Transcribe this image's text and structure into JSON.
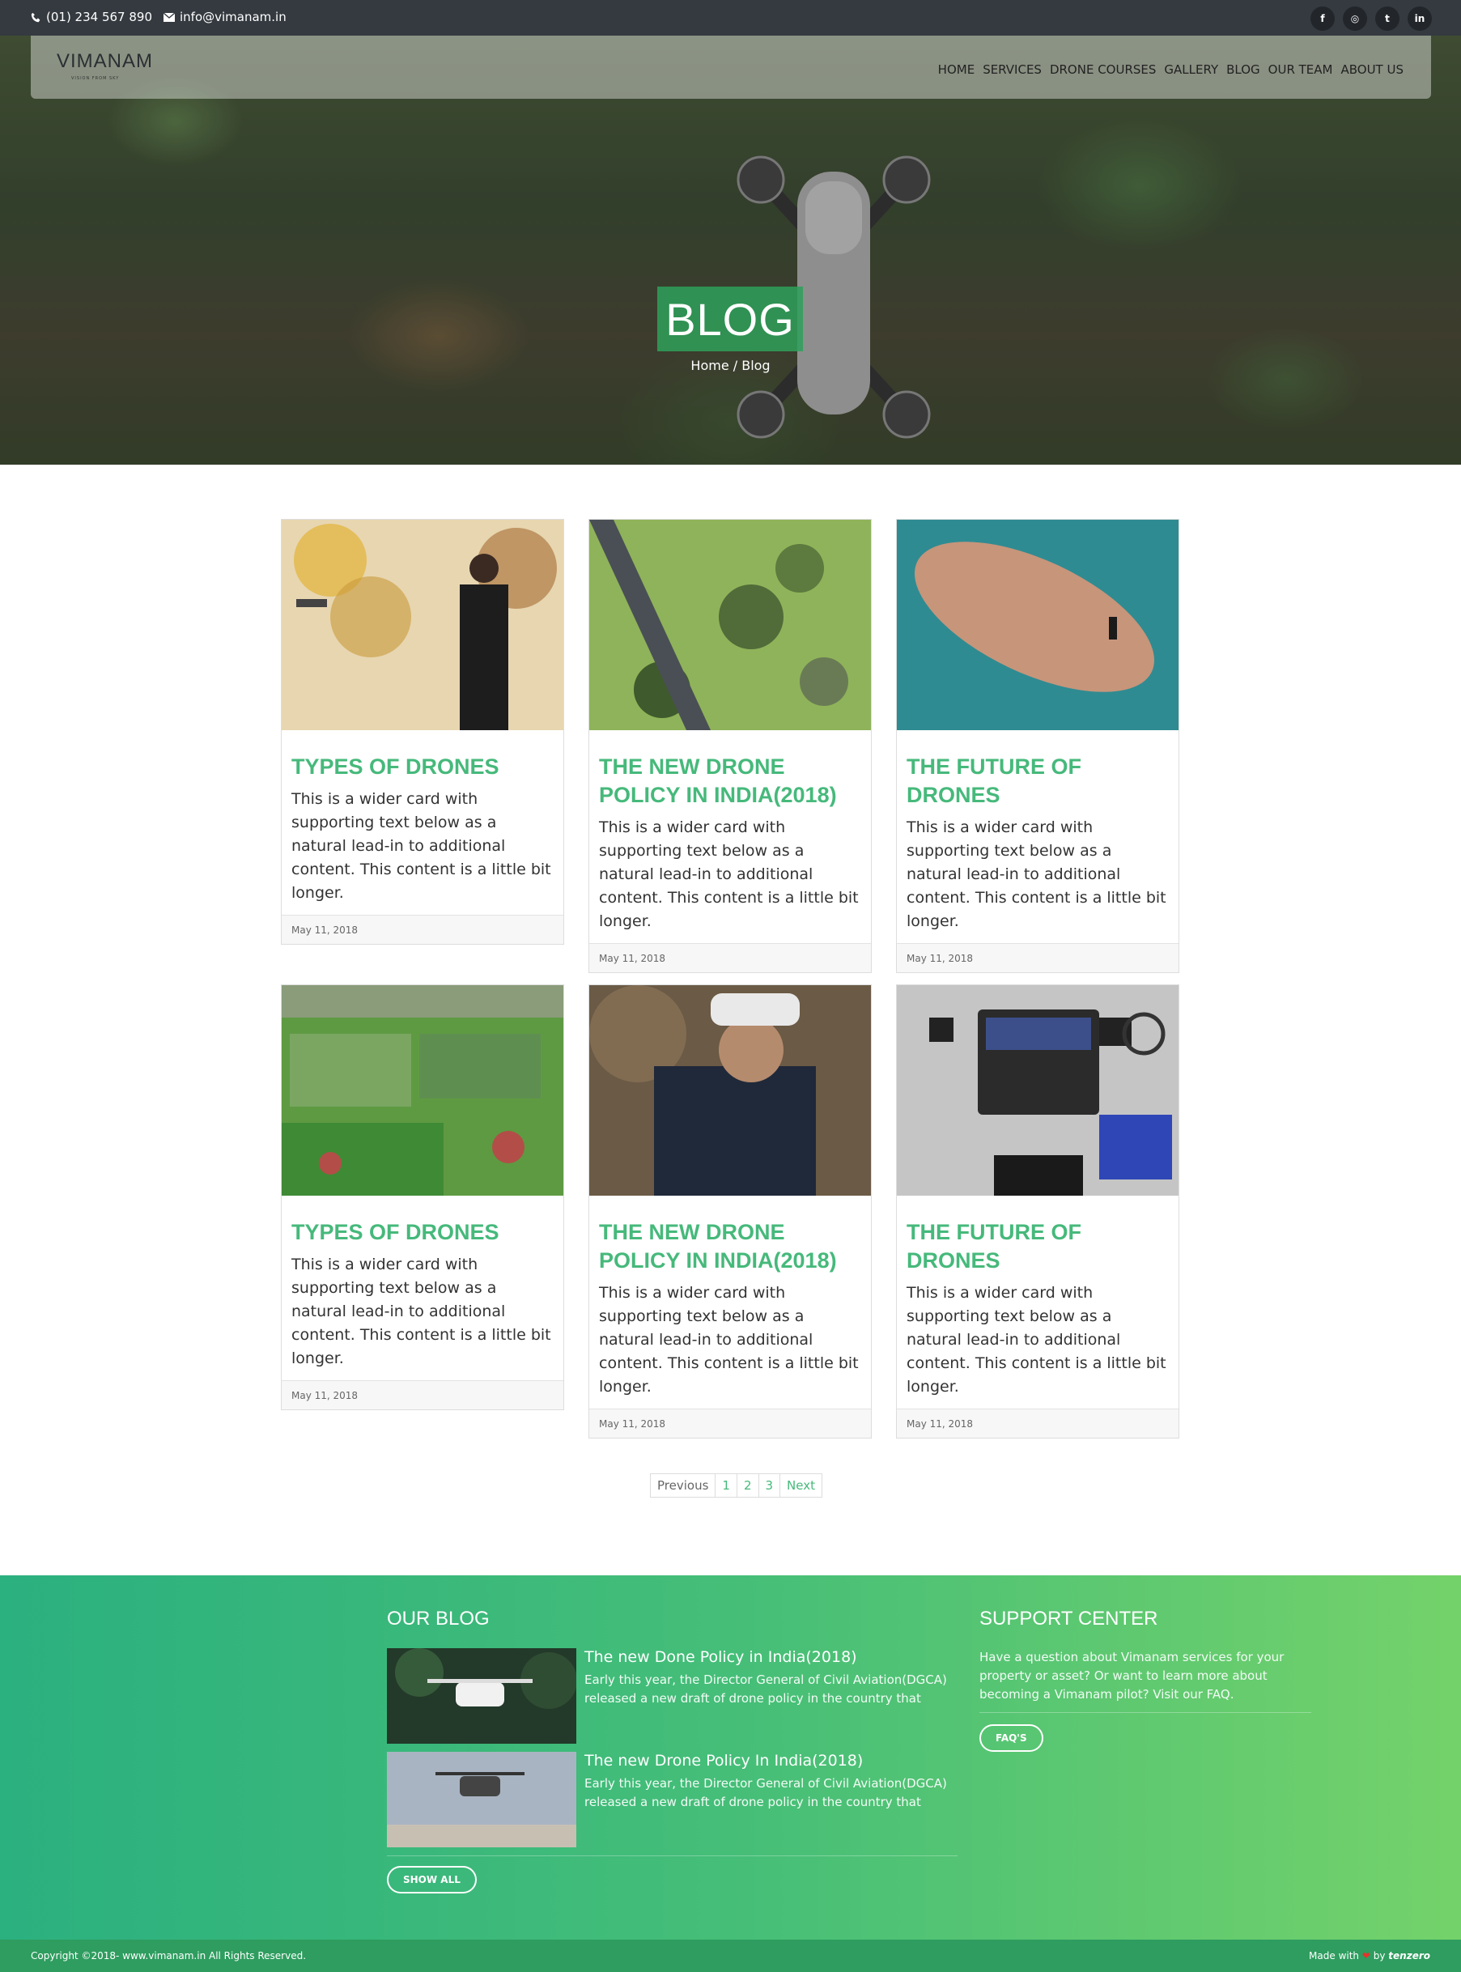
{
  "topbar": {
    "phone": "(01) 234 567 890",
    "email": "info@vimanam.in",
    "social": [
      {
        "icon": "facebook-icon",
        "label": "f"
      },
      {
        "icon": "instagram-icon",
        "label": "◎"
      },
      {
        "icon": "twitter-icon",
        "label": "t"
      },
      {
        "icon": "linkedin-icon",
        "label": "in"
      }
    ]
  },
  "brand": {
    "name": "VIMANAM",
    "tagline": "VISION FROM SKY"
  },
  "nav": [
    "HOME",
    "SERVICES",
    "DRONE COURSES",
    "GALLERY",
    "BLOG",
    "OUR TEAM",
    "ABOUT US"
  ],
  "hero": {
    "title": "BLOG",
    "breadcrumb": "Home / Blog"
  },
  "cards": [
    {
      "title": "TYPES OF DRONES",
      "text": "This is a wider card with supporting text below as a natural lead-in to additional content. This content is a little bit longer.",
      "date": "May 11, 2018"
    },
    {
      "title": "THE NEW DRONE POLICY IN INDIA(2018)",
      "text": "This is a wider card with supporting text below as a natural lead-in to additional content. This content is a little bit longer.",
      "date": "May 11, 2018"
    },
    {
      "title": "THE FUTURE OF DRONES",
      "text": "This is a wider card with supporting text below as a natural lead-in to additional content. This content is a little bit longer.",
      "date": "May 11, 2018"
    },
    {
      "title": "TYPES OF DRONES",
      "text": "This is a wider card with supporting text below as a natural lead-in to additional content. This content is a little bit longer.",
      "date": "May 11, 2018"
    },
    {
      "title": "THE NEW DRONE POLICY IN INDIA(2018)",
      "text": "This is a wider card with supporting text below as a natural lead-in to additional content. This content is a little bit longer.",
      "date": "May 11, 2018"
    },
    {
      "title": "THE FUTURE OF DRONES",
      "text": "This is a wider card with supporting text below as a natural lead-in to additional content. This content is a little bit longer.",
      "date": "May 11, 2018"
    }
  ],
  "pagination": {
    "prev": "Previous",
    "pages": [
      "1",
      "2",
      "3"
    ],
    "next": "Next"
  },
  "footer": {
    "blog_heading": "OUR BLOG",
    "posts": [
      {
        "title": "The new Done Policy in India(2018)",
        "excerpt": "Early this year, the Director General of Civil Aviation(DGCA) released a new draft of drone policy in the country that"
      },
      {
        "title": "The new Drone Policy In India(2018)",
        "excerpt": "Early this year, the Director General of Civil Aviation(DGCA) released a new draft of drone policy in the country that"
      }
    ],
    "show_all": "SHOW ALL",
    "support_heading": "SUPPORT CENTER",
    "support_text": "Have a question about Vimanam services for your property or asset? Or want to learn more about becoming a Vimanam pilot? Visit our FAQ.",
    "faq_button": "FAQ'S",
    "copyright": "Copyright ©2018- www.vimanam.in All Rights Reserved.",
    "made_with": "Made with",
    "by": "by",
    "maker": "tenzero"
  },
  "colors": {
    "accent": "#46b97b",
    "topbar": "#343a40",
    "footer_start": "#2bb07f",
    "footer_end": "#74d26a"
  }
}
